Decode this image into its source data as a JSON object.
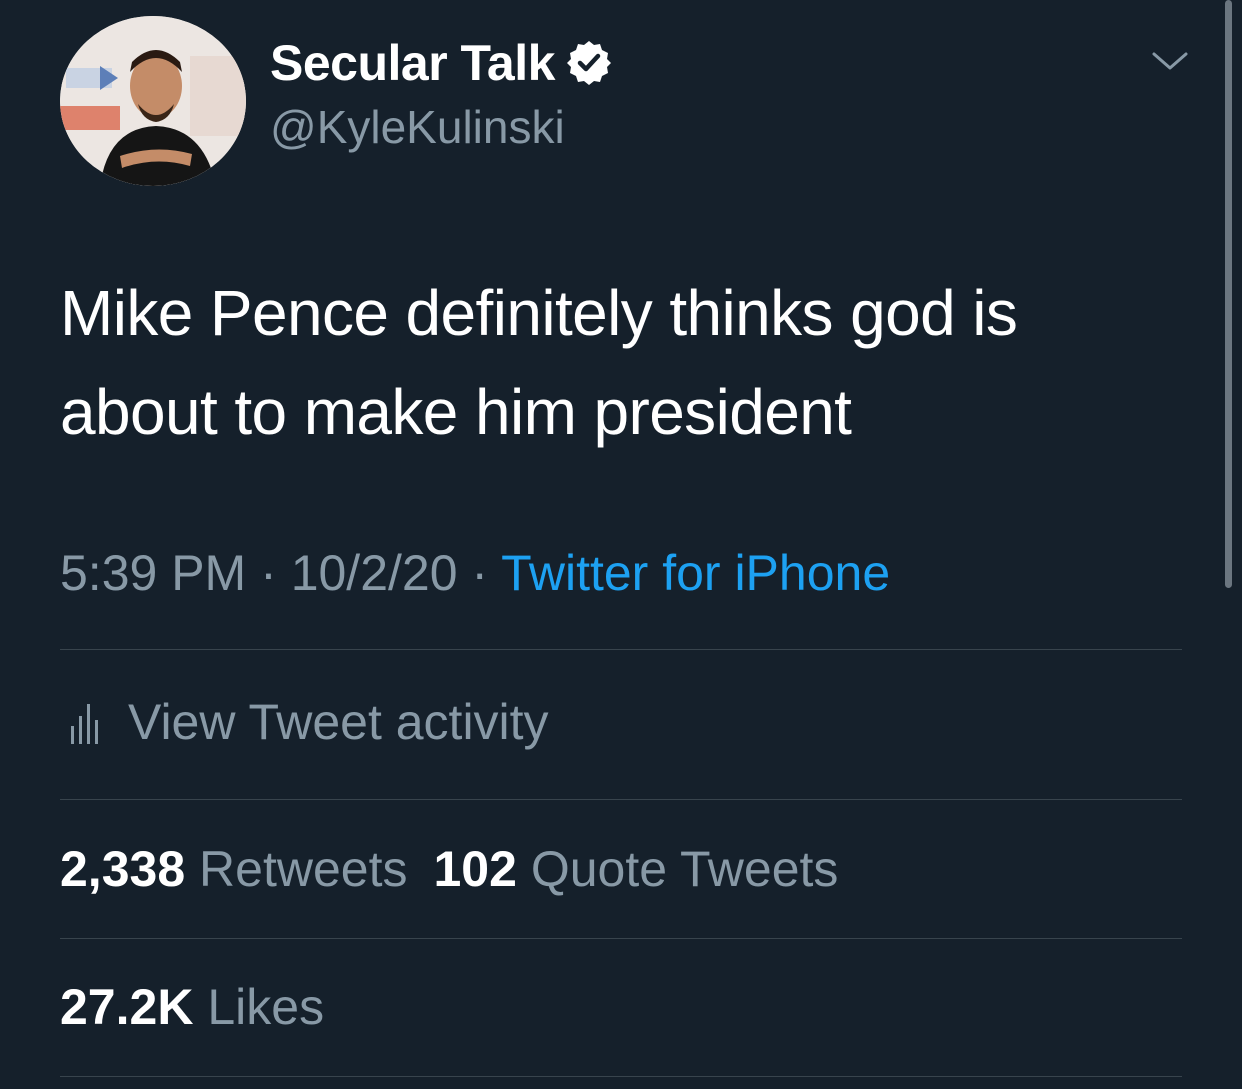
{
  "author": {
    "display_name": "Secular Talk",
    "handle": "@KyleKulinski",
    "verified_icon": "verified-badge-icon"
  },
  "tweet": {
    "text": "Mike Pence definitely thinks god is about to make him president",
    "time": "5:39 PM",
    "separator": "·",
    "date": "10/2/20",
    "source": "Twitter for iPhone"
  },
  "activity": {
    "label": "View Tweet activity",
    "icon": "bar-chart-icon"
  },
  "stats": {
    "retweets_count": "2,338",
    "retweets_label": "Retweets",
    "quotes_count": "102",
    "quotes_label": "Quote Tweets",
    "likes_count": "27.2K",
    "likes_label": "Likes"
  },
  "colors": {
    "background": "#15202b",
    "primary_text": "#ffffff",
    "secondary_text": "#8899a6",
    "accent": "#1da1f2",
    "divider": "#38444d"
  }
}
